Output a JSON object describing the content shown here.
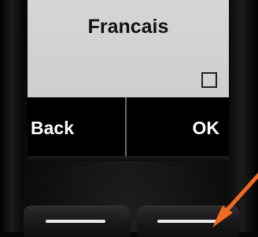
{
  "display": {
    "menu_item": "Francais",
    "option_checked": false
  },
  "softkeys": {
    "left_label": "Back",
    "right_label": "OK"
  },
  "annotation": {
    "arrow_color": "#f26a21",
    "points_to": "right-softkey-button"
  },
  "colors": {
    "display_bg": "#d3d3d3",
    "softkey_bar_bg": "#000000",
    "key_bar": "#e9e9e9"
  }
}
